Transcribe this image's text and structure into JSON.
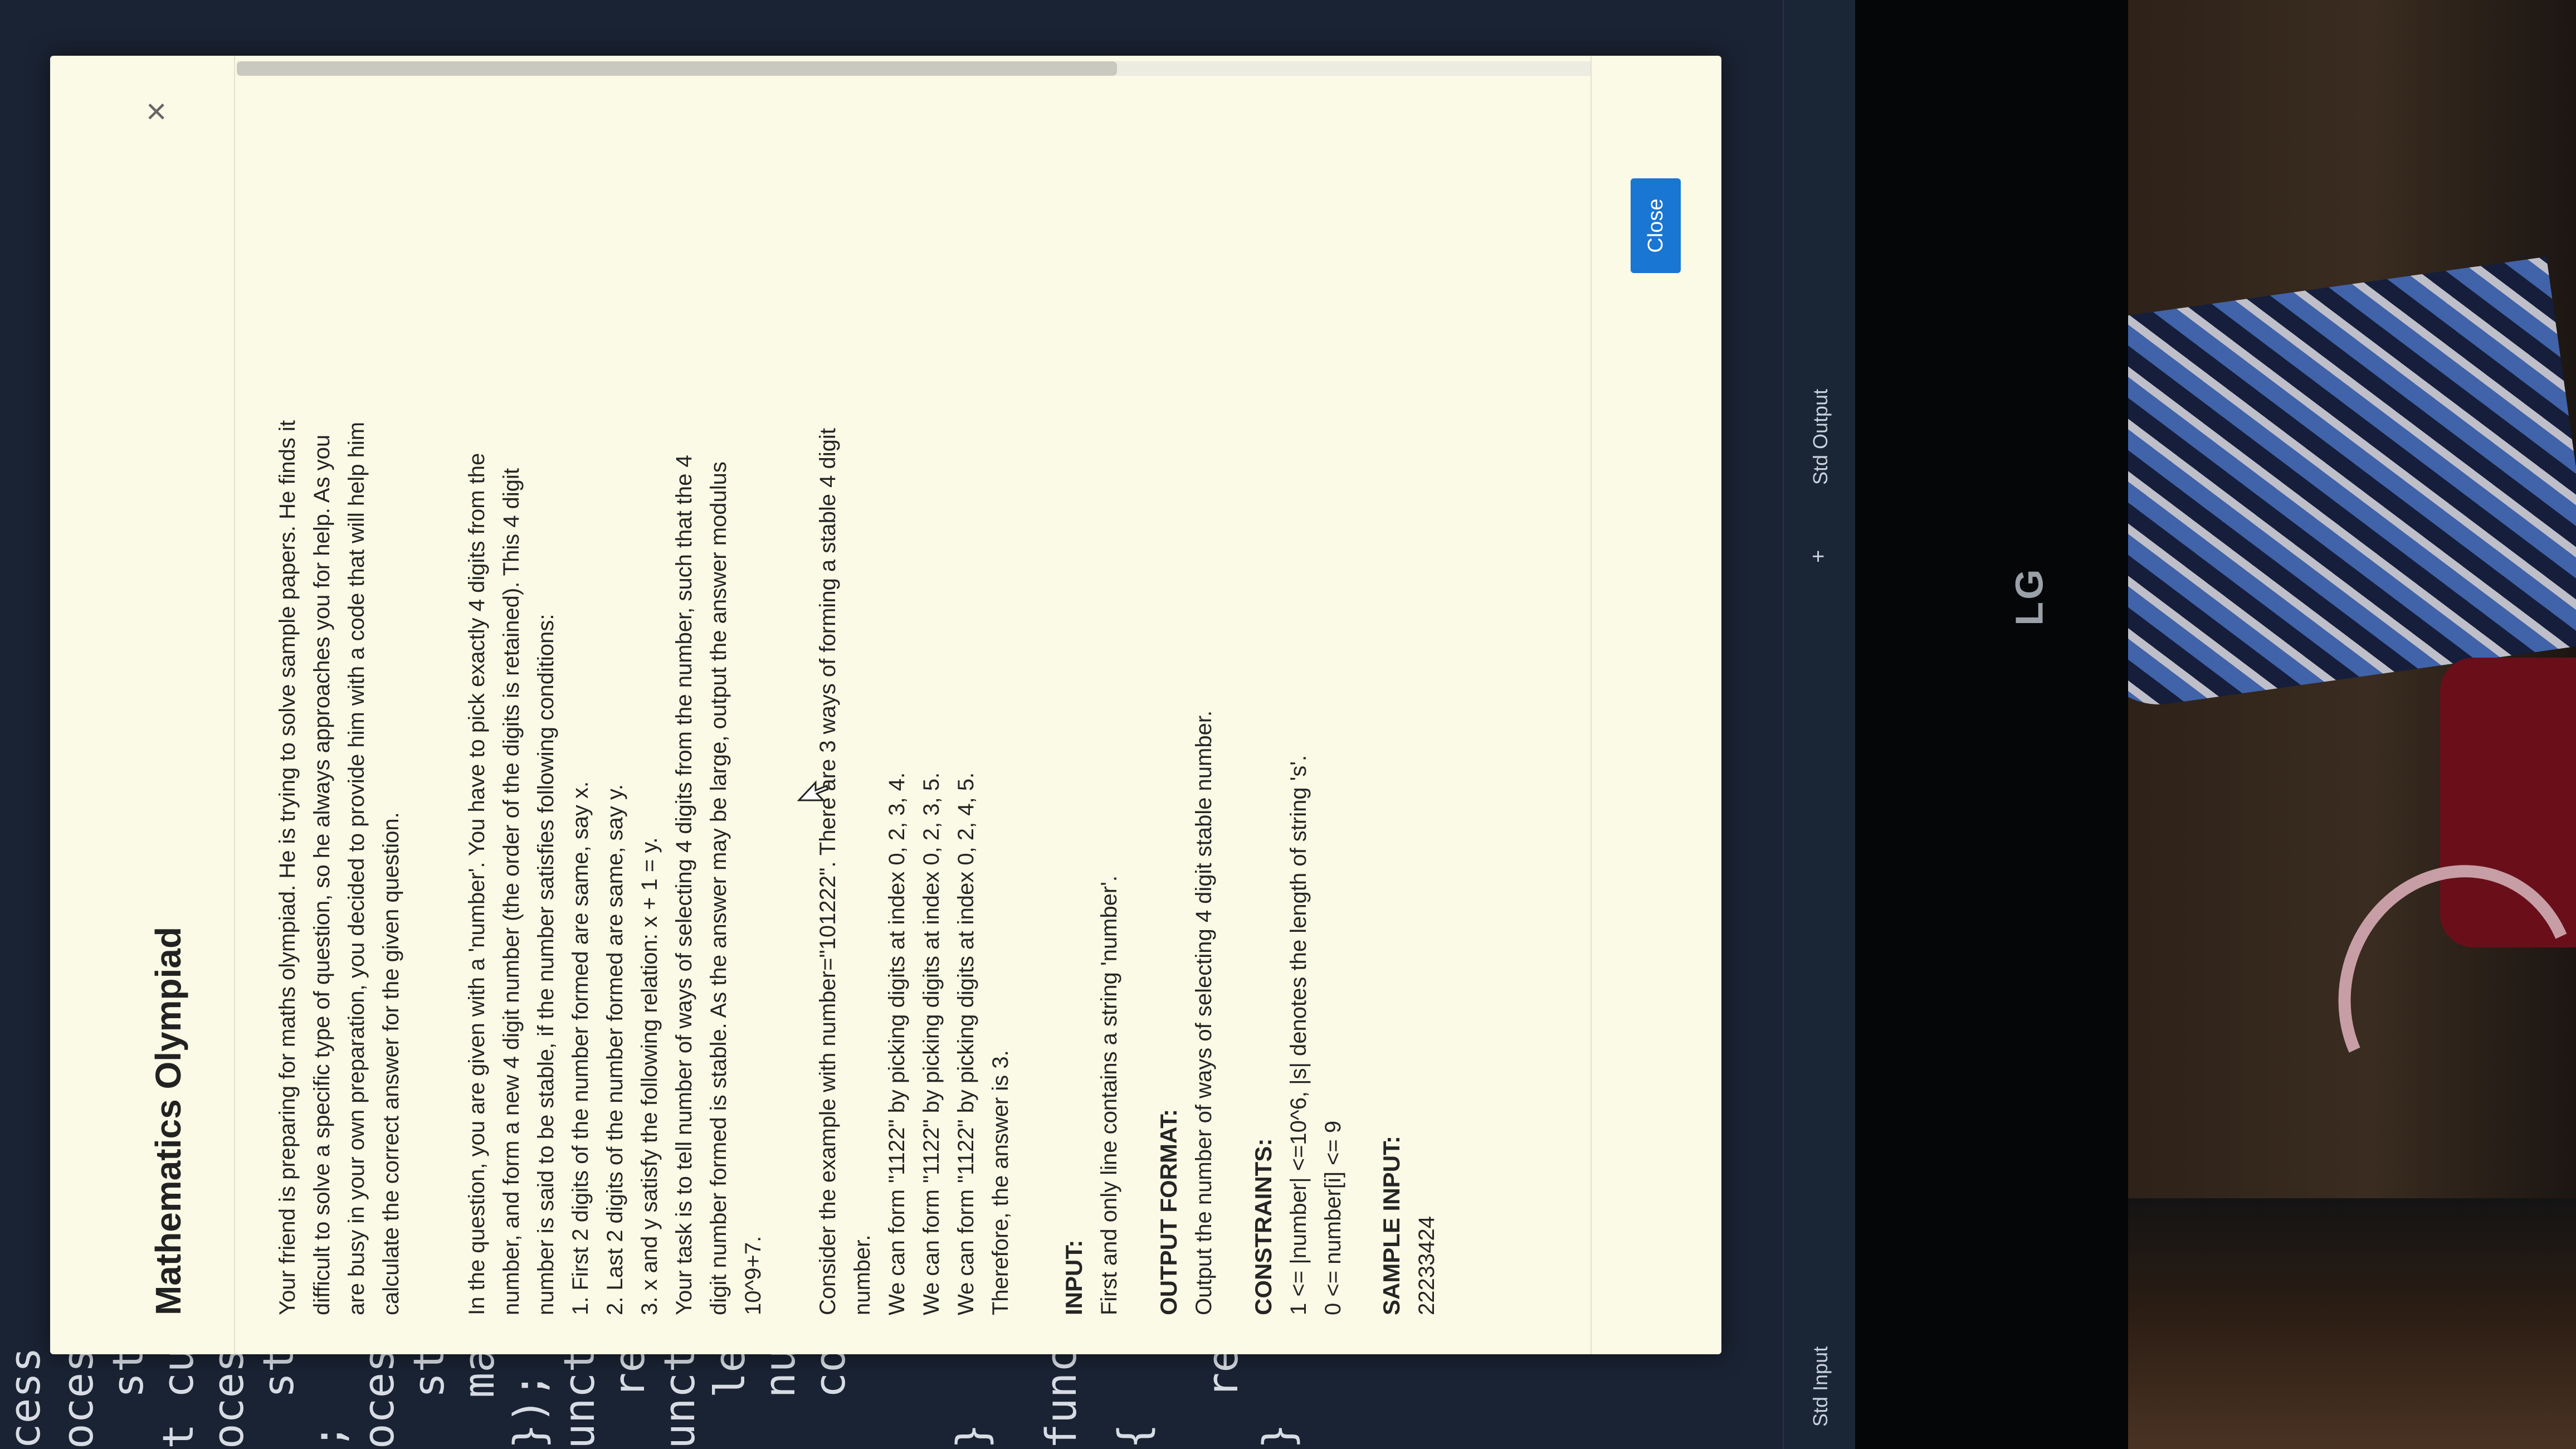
{
  "monitor": {
    "brand": "LG"
  },
  "editor": {
    "code_lines": [
      "cess",
      "ocess",
      "  std",
      "t cur",
      "ocess",
      "  std",
      ";",
      "ocess",
      "  stdi",
      "  main",
      "});",
      "unctic",
      "  ret",
      "unctic",
      "  let",
      "  num",
      "  cor",
      "}",
      "functic",
      "{",
      "  ret",
      "}"
    ]
  },
  "io_bar": {
    "std_input": "Std Input",
    "std_output": "Std Output",
    "add": "+"
  },
  "modal": {
    "title": "Mathematics Olympiad",
    "close_icon": "close-icon",
    "close_button": "Close",
    "intro": [
      "Your friend is preparing for maths olympiad. He is trying to solve sample papers. He finds it",
      "difficult to solve a specific type of question, so he always approaches you for help. As you",
      "are busy in your own preparation, you decided to provide him with a code that will help him",
      "calculate the correct answer for the given question."
    ],
    "question": [
      "In the question, you are given with a 'number'. You have to pick exactly 4 digits from the",
      "number, and form a new 4 digit number (the order of the digits is retained). This 4 digit",
      "number is said to be stable, if the number satisfies following conditions:",
      "1. First 2 digits of the number formed are same, say x.",
      "2. Last 2 digits of the number formed are same, say y.",
      "3. x and y satisfy the following relation: x + 1 = y.",
      "Your task is to tell number of ways of selecting 4 digits from the number, such that the 4",
      "digit number formed is stable. As the answer may be large, output the answer modulus",
      "10^9+7."
    ],
    "example": [
      "Consider the example with number=\"101222\". There are 3 ways of forming a stable 4 digit",
      "number.",
      "We can form \"1122\" by picking digits at index 0, 2, 3, 4.",
      "We can form \"1122\" by picking digits at index 0, 2, 3, 5.",
      "We can form \"1122\" by picking digits at index 0, 2, 4, 5.",
      "Therefore, the answer is 3."
    ],
    "input_heading": "INPUT:",
    "input_text": "First and only line contains a string 'number'.",
    "output_heading": "OUTPUT FORMAT:",
    "output_text": "Output the number of ways of selecting 4 digit stable number.",
    "constraints_heading": "CONSTRAINTS:",
    "constraints": [
      "1 <= |number| <=10^6, |s| denotes the length of string 's'.",
      "0 <= number[i] <= 9"
    ],
    "sample_input_heading": "SAMPLE INPUT:",
    "sample_input": "22233424"
  }
}
